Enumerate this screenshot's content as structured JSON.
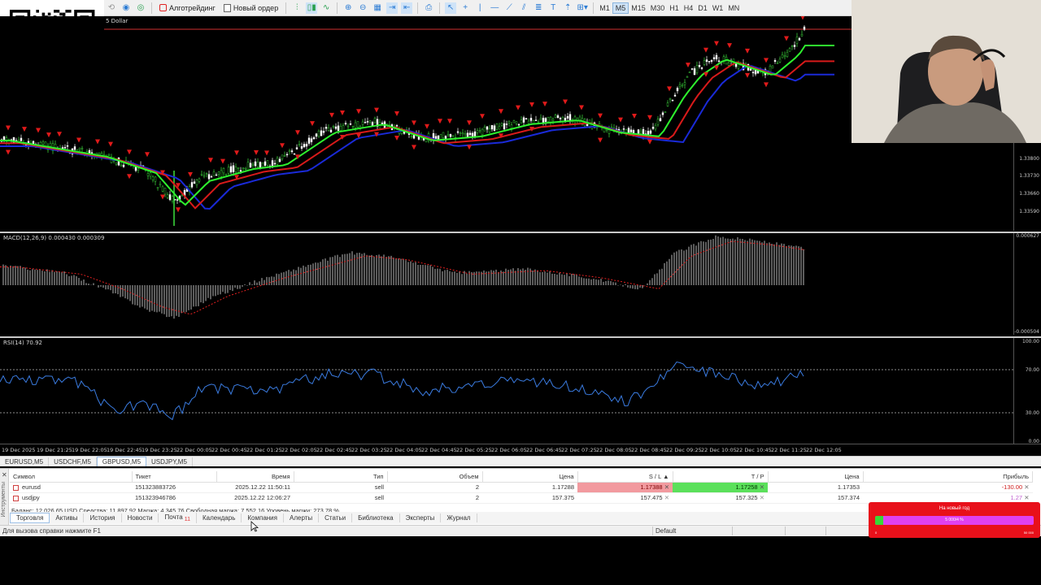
{
  "toolbar": {
    "algo_trading": "Алготрейдинг",
    "new_order": "Новый ордер",
    "timeframes": [
      "M1",
      "M5",
      "M15",
      "M30",
      "H1",
      "H4",
      "D1",
      "W1",
      "MN"
    ],
    "active_timeframe": "M5"
  },
  "main_chart": {
    "label": "5 Dollar",
    "price_ticks": [
      "1.33800",
      "1.33730",
      "1.33660",
      "1.33590"
    ]
  },
  "macd": {
    "label": "MACD(12,26,9) 0.000430 0.000309",
    "ticks": [
      "0.000627",
      "-0.000504"
    ]
  },
  "rsi": {
    "label": "RSI(14) 70.92",
    "ticks": [
      "100.00",
      "70.00",
      "30.00",
      "0.00"
    ]
  },
  "time_axis": [
    "19 Dec 2025",
    "19 Dec 21:25",
    "19 Dec 22:05",
    "19 Dec 22:45",
    "19 Dec 23:25",
    "22 Dec 00:05",
    "22 Dec 00:45",
    "22 Dec 01:25",
    "22 Dec 02:05",
    "22 Dec 02:45",
    "22 Dec 03:25",
    "22 Dec 04:05",
    "22 Dec 04:45",
    "22 Dec 05:25",
    "22 Dec 06:05",
    "22 Dec 06:45",
    "22 Dec 07:25",
    "22 Dec 08:05",
    "22 Dec 08:45",
    "22 Dec 09:25",
    "22 Dec 10:05",
    "22 Dec 10:45",
    "22 Dec 11:25",
    "22 Dec 12:05"
  ],
  "chart_tabs": [
    "EURUSD,M5",
    "USDCHF,M5",
    "GBPUSD,M5",
    "USDJPY,M5"
  ],
  "active_chart_tab": "GBPUSD,M5",
  "terminal": {
    "side_label": "Инструменты",
    "columns": [
      "Символ",
      "Тикет",
      "Время",
      "Тип",
      "Объем",
      "Цена",
      "S / L",
      "T / P",
      "Цена",
      "Прибыль"
    ],
    "rows": [
      {
        "symbol": "eurusd",
        "ticket": "151323883726",
        "time": "2025.12.22 11:50:11",
        "type": "sell",
        "volume": "2",
        "price": "1.17288",
        "sl": "1.17388",
        "tp": "1.17258",
        "cur_price": "1.17353",
        "profit": "-130.00"
      },
      {
        "symbol": "usdjpy",
        "ticket": "151323946786",
        "time": "2025.12.22 12:06:27",
        "type": "sell",
        "volume": "2",
        "price": "157.375",
        "sl": "157.475",
        "tp": "157.325",
        "cur_price": "157.374",
        "profit": "1.27"
      }
    ],
    "balance": "Баланс: 12 026.65 USD  Средства: 11 897.92  Маржа: 4 345.76  Свободная маржа: 7 552.16  Уровень маржи: 273.78 %",
    "tabs": [
      "Торговля",
      "Активы",
      "История",
      "Новости",
      "Почта",
      "Календарь",
      "Компания",
      "Алерты",
      "Статьи",
      "Библиотека",
      "Эксперты",
      "Журнал"
    ],
    "active_tab": "Торговля",
    "mail_badge": "11"
  },
  "status": {
    "help": "Для вызова справки нажмите F1",
    "profile": "Default"
  },
  "promo": {
    "title": "На новый год",
    "progress": 0.05,
    "progress_label": "5 000/4 %",
    "min": "0",
    "max": "50 000"
  }
}
